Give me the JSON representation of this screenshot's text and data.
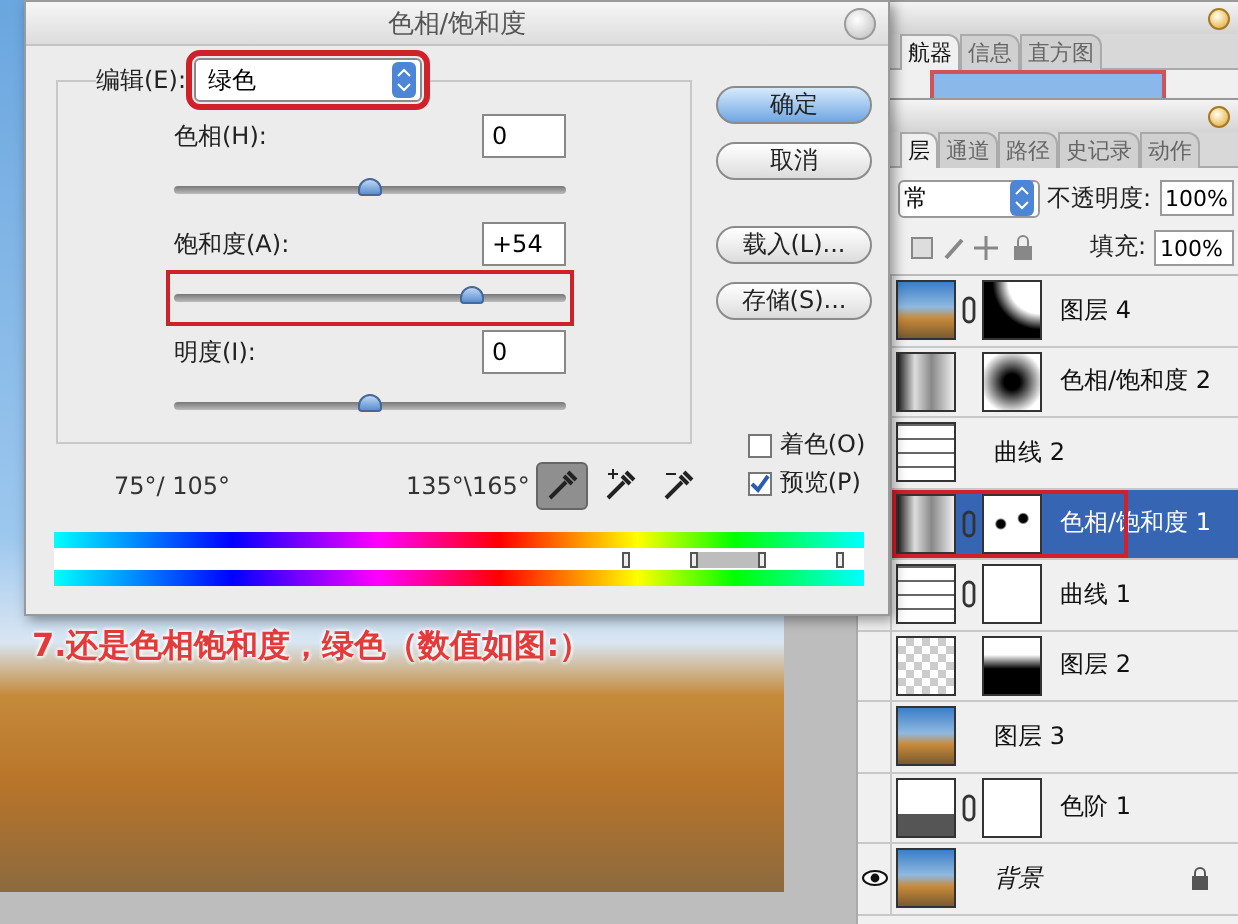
{
  "caption": "7.还是色相饱和度，绿色（数值如图:）",
  "dialog": {
    "title": "色相/饱和度",
    "edit": {
      "label": "编辑(E):",
      "value": "绿色",
      "highlighted": true
    },
    "sliders": [
      {
        "label": "色相(H):",
        "value": "0",
        "level": 0.5,
        "highlighted": false
      },
      {
        "label": "饱和度(A):",
        "value": "+54",
        "level": 0.76,
        "highlighted": true
      },
      {
        "label": "明度(I):",
        "value": "0",
        "level": 0.5,
        "highlighted": false
      }
    ],
    "buttons": [
      {
        "label": "确定",
        "default": true
      },
      {
        "label": "取消",
        "default": false
      },
      {
        "label": "载入(L)...",
        "default": false
      },
      {
        "label": "存储(S)...",
        "default": false
      }
    ],
    "checkboxes": [
      {
        "label": "着色(O)",
        "checked": false
      },
      {
        "label": "预览(P)",
        "checked": true
      }
    ],
    "range_left": "75°/ 105°",
    "range_right": "135°\\165°",
    "eyedroppers": [
      {
        "kind": "plain",
        "selected": true
      },
      {
        "kind": "plus",
        "selected": false
      },
      {
        "kind": "minus",
        "selected": false
      }
    ],
    "range_markers": [
      {
        "level": 0.705
      },
      {
        "level": 0.79
      },
      {
        "level": 0.875
      },
      {
        "level": 0.97
      }
    ]
  },
  "navigator_panel": {
    "tabs": [
      {
        "label": "航器",
        "selected": true
      },
      {
        "label": "信息",
        "selected": false
      },
      {
        "label": "直方图",
        "selected": false
      }
    ]
  },
  "layers_panel": {
    "tabs": [
      {
        "label": "层",
        "selected": true
      },
      {
        "label": "通道",
        "selected": false
      },
      {
        "label": "路径",
        "selected": false
      },
      {
        "label": "史记录",
        "selected": false
      },
      {
        "label": "动作",
        "selected": false
      }
    ],
    "blend_mode": "常",
    "opacity_label": "不透明度:",
    "opacity": "100%",
    "fill_label": "填充:",
    "fill": "100%",
    "layers": [
      {
        "name": "图层 4",
        "kind": "pixel",
        "mask": {
          "kind": "corner"
        },
        "linked": true,
        "selected": false,
        "locked": false,
        "highlighted": false
      },
      {
        "name": "色相/饱和度 2",
        "kind": "hue",
        "mask": {
          "kind": "radial"
        },
        "linked": false,
        "selected": false,
        "locked": false,
        "highlighted": false
      },
      {
        "name": "曲线 2",
        "kind": "curves",
        "linked": false,
        "selected": false,
        "locked": false,
        "highlighted": false
      },
      {
        "name": "色相/饱和度 1",
        "kind": "hue",
        "mask": {
          "kind": "spots"
        },
        "linked": true,
        "selected": true,
        "locked": false,
        "highlighted": true
      },
      {
        "name": "曲线 1",
        "kind": "curves",
        "mask": {
          "kind": "white"
        },
        "linked": true,
        "selected": false,
        "locked": false,
        "highlighted": false
      },
      {
        "name": "图层 2",
        "kind": "transparent",
        "mask": {
          "kind": "silhouette"
        },
        "linked": false,
        "selected": false,
        "visible": false,
        "locked": false,
        "highlighted": false
      },
      {
        "name": "图层 3",
        "kind": "pixel",
        "linked": false,
        "selected": false,
        "visible": false,
        "locked": false,
        "highlighted": false
      },
      {
        "name": "色阶 1",
        "kind": "levels",
        "mask": {
          "kind": "white"
        },
        "linked": true,
        "selected": false,
        "visible": false,
        "locked": false,
        "highlighted": false
      },
      {
        "name": "背景",
        "kind": "pixel",
        "linked": false,
        "selected": false,
        "visible": true,
        "locked": true,
        "highlighted": false,
        "italic": true
      }
    ]
  }
}
